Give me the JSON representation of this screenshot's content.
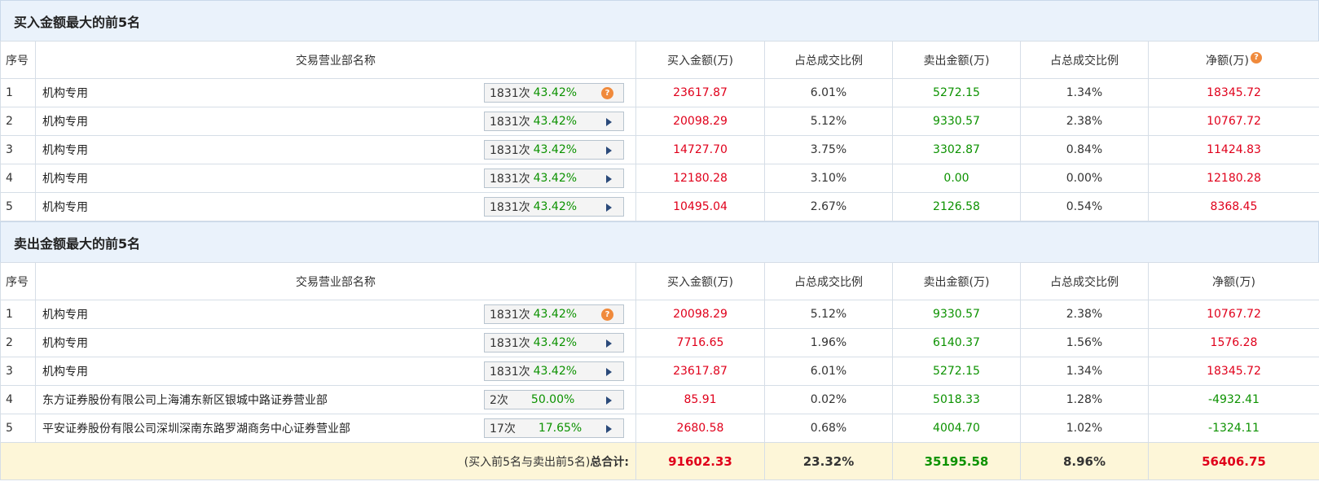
{
  "buy_section": {
    "title": "买入金额最大的前5名",
    "headers": {
      "rank": "序号",
      "name": "交易营业部名称",
      "buy": "买入金额(万)",
      "buy_pct": "占总成交比例",
      "sell": "卖出金额(万)",
      "sell_pct": "占总成交比例",
      "net": "净额(万)"
    },
    "rows": [
      {
        "rank": "1",
        "name": "机构专用",
        "times": "1831次",
        "pct": "43.42%",
        "icon": "help-icon",
        "buy": "23617.87",
        "buy_pct": "6.01%",
        "sell": "5272.15",
        "sell_pct": "1.34%",
        "net": "18345.72"
      },
      {
        "rank": "2",
        "name": "机构专用",
        "times": "1831次",
        "pct": "43.42%",
        "icon": "arrow-icon",
        "buy": "20098.29",
        "buy_pct": "5.12%",
        "sell": "9330.57",
        "sell_pct": "2.38%",
        "net": "10767.72"
      },
      {
        "rank": "3",
        "name": "机构专用",
        "times": "1831次",
        "pct": "43.42%",
        "icon": "arrow-icon",
        "buy": "14727.70",
        "buy_pct": "3.75%",
        "sell": "3302.87",
        "sell_pct": "0.84%",
        "net": "11424.83"
      },
      {
        "rank": "4",
        "name": "机构专用",
        "times": "1831次",
        "pct": "43.42%",
        "icon": "arrow-icon",
        "buy": "12180.28",
        "buy_pct": "3.10%",
        "sell": "0.00",
        "sell_pct": "0.00%",
        "net": "12180.28"
      },
      {
        "rank": "5",
        "name": "机构专用",
        "times": "1831次",
        "pct": "43.42%",
        "icon": "arrow-icon",
        "buy": "10495.04",
        "buy_pct": "2.67%",
        "sell": "2126.58",
        "sell_pct": "0.54%",
        "net": "8368.45"
      }
    ]
  },
  "sell_section": {
    "title": "卖出金额最大的前5名",
    "headers": {
      "rank": "序号",
      "name": "交易营业部名称",
      "buy": "买入金额(万)",
      "buy_pct": "占总成交比例",
      "sell": "卖出金额(万)",
      "sell_pct": "占总成交比例",
      "net": "净额(万)"
    },
    "rows": [
      {
        "rank": "1",
        "name": "机构专用",
        "times": "1831次",
        "pct": "43.42%",
        "icon": "help-icon",
        "buy": "20098.29",
        "buy_pct": "5.12%",
        "sell": "9330.57",
        "sell_pct": "2.38%",
        "net": "10767.72"
      },
      {
        "rank": "2",
        "name": "机构专用",
        "times": "1831次",
        "pct": "43.42%",
        "icon": "arrow-icon",
        "buy": "7716.65",
        "buy_pct": "1.96%",
        "sell": "6140.37",
        "sell_pct": "1.56%",
        "net": "1576.28"
      },
      {
        "rank": "3",
        "name": "机构专用",
        "times": "1831次",
        "pct": "43.42%",
        "icon": "arrow-icon",
        "buy": "23617.87",
        "buy_pct": "6.01%",
        "sell": "5272.15",
        "sell_pct": "1.34%",
        "net": "18345.72"
      },
      {
        "rank": "4",
        "name": "东方证券股份有限公司上海浦东新区银城中路证券营业部",
        "times": "2次",
        "pct": "50.00%",
        "icon": "arrow-icon",
        "buy": "85.91",
        "buy_pct": "0.02%",
        "sell": "5018.33",
        "sell_pct": "1.28%",
        "net": "-4932.41"
      },
      {
        "rank": "5",
        "name": "平安证券股份有限公司深圳深南东路罗湖商务中心证券营业部",
        "times": "17次",
        "pct": "17.65%",
        "icon": "arrow-icon",
        "buy": "2680.58",
        "buy_pct": "0.68%",
        "sell": "4004.70",
        "sell_pct": "1.02%",
        "net": "-1324.11"
      }
    ]
  },
  "total": {
    "label_prefix": "(买入前5名与卖出前5名)",
    "label_suffix": "总合计:",
    "buy": "91602.33",
    "buy_pct": "23.32%",
    "sell": "35195.58",
    "sell_pct": "8.96%",
    "net": "56406.75"
  },
  "colors": {
    "buy": "#e0001b",
    "sell": "#0c9200",
    "header_bg": "#eaf2fb",
    "total_bg": "#fdf6d8",
    "help_icon": "#f08a3c",
    "arrow_icon": "#2b4a7a"
  }
}
